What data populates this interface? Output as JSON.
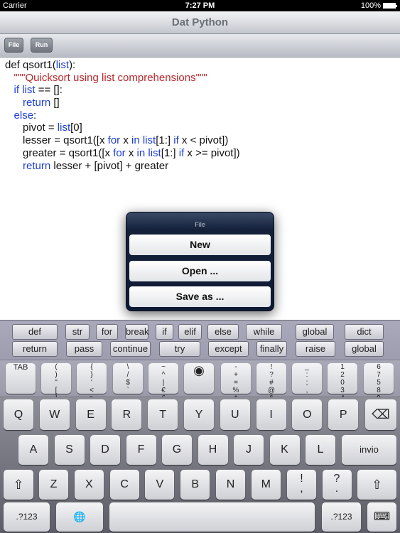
{
  "status": {
    "carrier": "Carrier",
    "time": "7:27 PM",
    "battery": "100%"
  },
  "title": "Dat Python",
  "toolbar": {
    "file": "File",
    "run": "Run"
  },
  "code": [
    [
      [
        "def ",
        ""
      ],
      [
        "qsort1(",
        ""
      ],
      [
        "list",
        "kw"
      ],
      [
        "):",
        ""
      ]
    ],
    [
      [
        "   ",
        ""
      ],
      [
        "\"\"\"Quicksort using list comprehensions\"\"\"",
        "st"
      ]
    ],
    [
      [
        "   ",
        ""
      ],
      [
        "if",
        "kw"
      ],
      [
        " ",
        ""
      ],
      [
        "list",
        "kw"
      ],
      [
        " == []:",
        ""
      ]
    ],
    [
      [
        "      ",
        ""
      ],
      [
        "return",
        "kw"
      ],
      [
        " []",
        ""
      ]
    ],
    [
      [
        "   ",
        ""
      ],
      [
        "else",
        "kw"
      ],
      [
        ":",
        ""
      ]
    ],
    [
      [
        "      ",
        ""
      ],
      [
        "pivot = ",
        ""
      ],
      [
        "list",
        "kw"
      ],
      [
        "[0]",
        ""
      ]
    ],
    [
      [
        "      ",
        ""
      ],
      [
        "lesser = qsort1([x ",
        ""
      ],
      [
        "for",
        "kw"
      ],
      [
        " x ",
        ""
      ],
      [
        "in",
        "kw"
      ],
      [
        " ",
        ""
      ],
      [
        "list",
        "kw"
      ],
      [
        "[1:] ",
        ""
      ],
      [
        "if",
        "kw"
      ],
      [
        " x < pivot])",
        ""
      ]
    ],
    [
      [
        "      ",
        ""
      ],
      [
        "greater = qsort1([x ",
        ""
      ],
      [
        "for",
        "kw"
      ],
      [
        " x ",
        ""
      ],
      [
        "in",
        "kw"
      ],
      [
        " ",
        ""
      ],
      [
        "list",
        "kw"
      ],
      [
        "[1:] ",
        ""
      ],
      [
        "if",
        "kw"
      ],
      [
        " x >= pivot])",
        ""
      ]
    ],
    [
      [
        "      ",
        ""
      ],
      [
        "return",
        "kw"
      ],
      [
        " lesser + [pivot] + greater",
        ""
      ]
    ]
  ],
  "popover": {
    "title": "File",
    "buttons": [
      "New",
      "Open ...",
      "Save as ..."
    ]
  },
  "keywords": {
    "row1": [
      "def",
      "str",
      "for",
      "break",
      "if",
      "elif",
      "else",
      "while",
      "global",
      "dict"
    ],
    "row2": [
      "return",
      "pass",
      "continue",
      "try",
      "except",
      "finally",
      "raise",
      "global"
    ]
  },
  "symbols": [
    [
      "TAB"
    ],
    [
      "(",
      ")",
      "\"",
      "[",
      "]"
    ],
    [
      "{",
      "}",
      "'",
      "<",
      ">"
    ],
    [
      "\\",
      "/",
      "$",
      "`",
      "."
    ],
    [
      "~",
      "^",
      "|",
      "€",
      "£"
    ],
    [
      "◉"
    ],
    [
      "-",
      "+",
      "=",
      "%",
      "*"
    ],
    [
      "!",
      "?",
      "#",
      "@",
      "&"
    ],
    [
      "_",
      ":",
      ";",
      ",",
      "."
    ],
    [
      "1",
      "2",
      "0",
      "3",
      "4"
    ],
    [
      "6",
      "7",
      "5",
      "8",
      "9"
    ]
  ],
  "keys": {
    "row1": [
      "Q",
      "W",
      "E",
      "R",
      "T",
      "Y",
      "U",
      "I",
      "O",
      "P"
    ],
    "backspace": "⌫",
    "row2": [
      "A",
      "S",
      "D",
      "F",
      "G",
      "H",
      "J",
      "K",
      "L"
    ],
    "return": "invio",
    "row3": [
      "Z",
      "X",
      "C",
      "V",
      "B",
      "N",
      "M"
    ],
    "punct": [
      [
        "!",
        ","
      ],
      [
        "?",
        "."
      ]
    ],
    "shift": "⇧",
    "numbers": ".?123",
    "globe": "🌐",
    "hide": "⌨"
  },
  "colors": {
    "keyword": "#1d3fd6",
    "string": "#b8262b"
  }
}
